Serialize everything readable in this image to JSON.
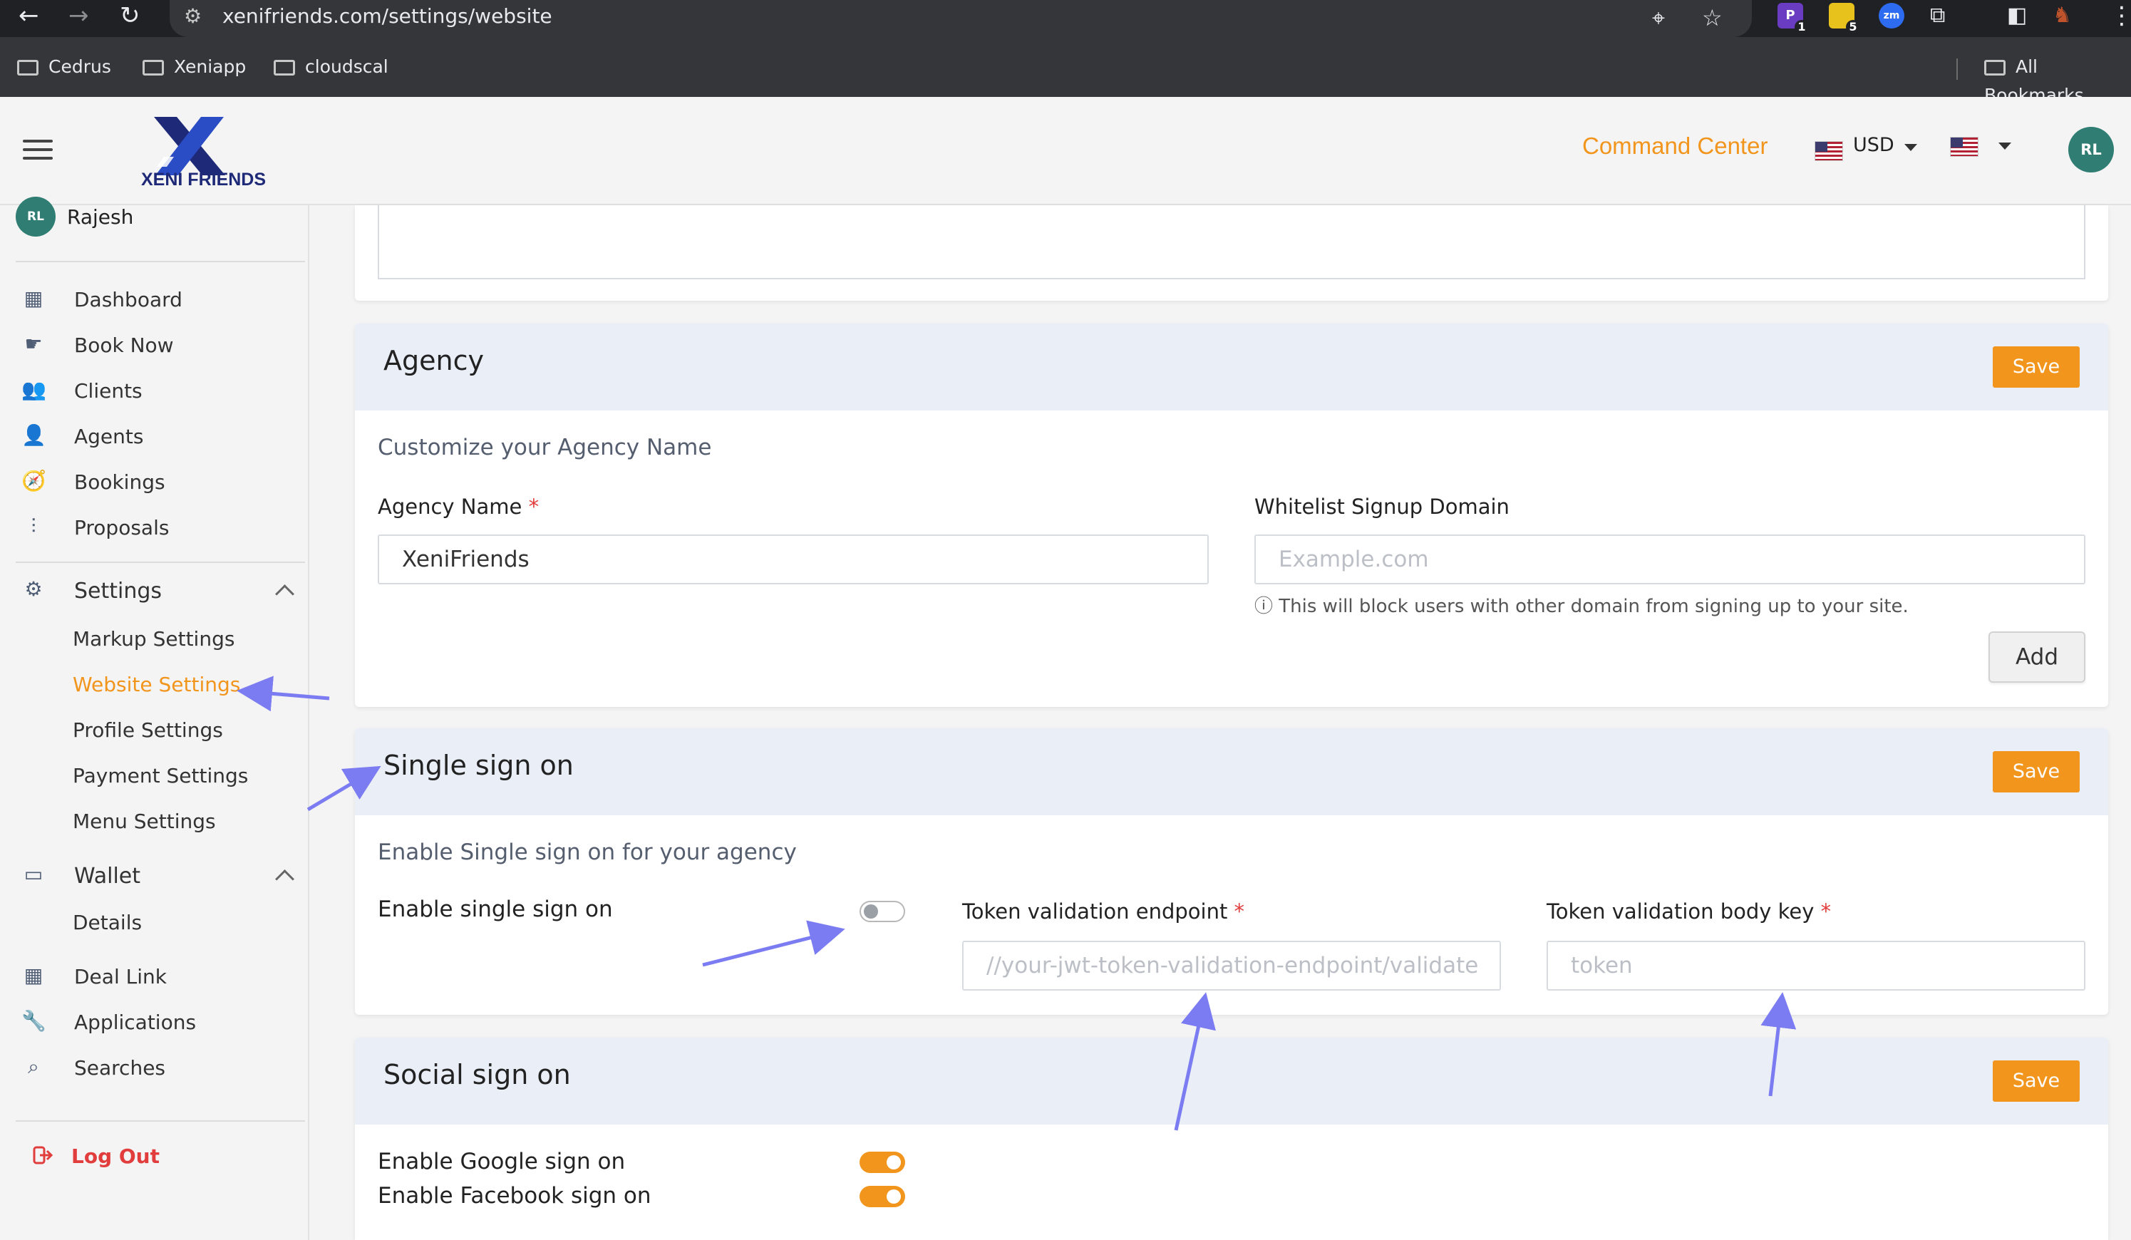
{
  "browser": {
    "url": "xenifriends.com/settings/website",
    "bookmarks": [
      "Cedrus",
      "Xeniapp",
      "cloudscal"
    ],
    "all_bookmarks": "All Bookmarks",
    "extensions": [
      {
        "name": "P",
        "badge": "1",
        "color": "#6a3cc2"
      },
      {
        "name": "",
        "badge": "5",
        "color": "#e8c21c"
      },
      {
        "name": "zm",
        "badge": "",
        "color": "#2d6cf0"
      }
    ]
  },
  "header": {
    "brand": "XENI FRIENDS",
    "command_center": "Command Center",
    "currency": "USD",
    "avatar_initials": "RL"
  },
  "sidebar": {
    "user": {
      "initials": "RL",
      "name": "Rajesh"
    },
    "items": [
      {
        "label": "Dashboard",
        "icon": "grid-icon"
      },
      {
        "label": "Book Now",
        "icon": "hand-pointer-icon"
      },
      {
        "label": "Clients",
        "icon": "users-icon"
      },
      {
        "label": "Agents",
        "icon": "user-tie-icon"
      },
      {
        "label": "Bookings",
        "icon": "compass-icon"
      },
      {
        "label": "Proposals",
        "icon": "sliders-icon"
      }
    ],
    "settings": {
      "label": "Settings",
      "icon": "gear-icon",
      "children": [
        "Markup Settings",
        "Website Settings",
        "Profile Settings",
        "Payment Settings",
        "Menu Settings"
      ],
      "active": "Website Settings"
    },
    "wallet": {
      "label": "Wallet",
      "icon": "wallet-icon",
      "children": [
        "Details"
      ]
    },
    "bottom_items": [
      {
        "label": "Deal Link",
        "icon": "grid-icon"
      },
      {
        "label": "Applications",
        "icon": "wrench-icon"
      },
      {
        "label": "Searches",
        "icon": "search-icon"
      }
    ],
    "logout": "Log Out"
  },
  "agency": {
    "title": "Agency",
    "save": "Save",
    "subtitle": "Customize your Agency Name",
    "name_label": "Agency Name",
    "name_value": "XeniFriends",
    "domain_label": "Whitelist Signup Domain",
    "domain_placeholder": "Example.com",
    "domain_hint": "This will block users with other domain from signing up to your site.",
    "add": "Add"
  },
  "sso": {
    "title": "Single sign on",
    "save": "Save",
    "subtitle": "Enable Single sign on for your agency",
    "enable_label": "Enable single sign on",
    "enabled": false,
    "endpoint_label": "Token validation endpoint",
    "endpoint_placeholder": "//your-jwt-token-validation-endpoint/validate",
    "body_key_label": "Token validation body key",
    "body_key_placeholder": "token"
  },
  "social": {
    "title": "Social sign on",
    "save": "Save",
    "google_label": "Enable Google sign on",
    "google_enabled": true,
    "facebook_label": "Enable Facebook sign on",
    "facebook_enabled": true
  },
  "colors": {
    "accent": "#f2951c",
    "danger": "#e23d3d",
    "card_header": "#e9eef7",
    "avatar": "#2f7d73",
    "annotation": "#7b7bf2"
  }
}
